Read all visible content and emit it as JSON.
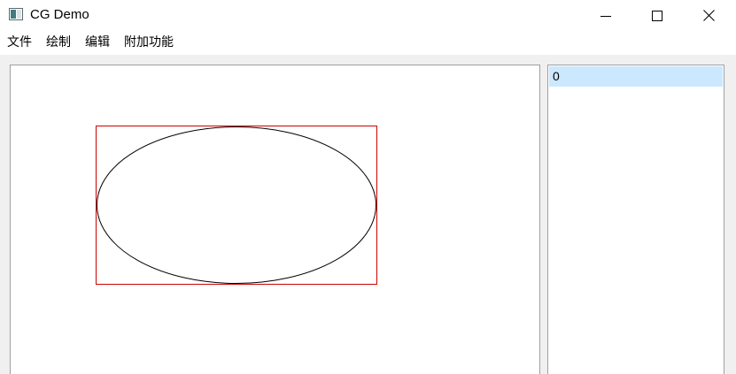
{
  "window": {
    "title": "CG Demo",
    "icon": "app-window-icon",
    "controls": {
      "minimize_icon": "minimize-icon",
      "maximize_icon": "maximize-icon",
      "close_icon": "close-icon"
    }
  },
  "menu": {
    "items": [
      {
        "label": "文件"
      },
      {
        "label": "绘制"
      },
      {
        "label": "编辑"
      },
      {
        "label": "附加功能"
      }
    ]
  },
  "canvas": {
    "shapes": [
      {
        "type": "ellipse",
        "stroke": "#000000",
        "selected": true,
        "selection_color": "#cc0000"
      }
    ]
  },
  "item_list": {
    "items": [
      {
        "label": "0",
        "selected": true
      }
    ],
    "selected_color": "#cce8ff"
  }
}
